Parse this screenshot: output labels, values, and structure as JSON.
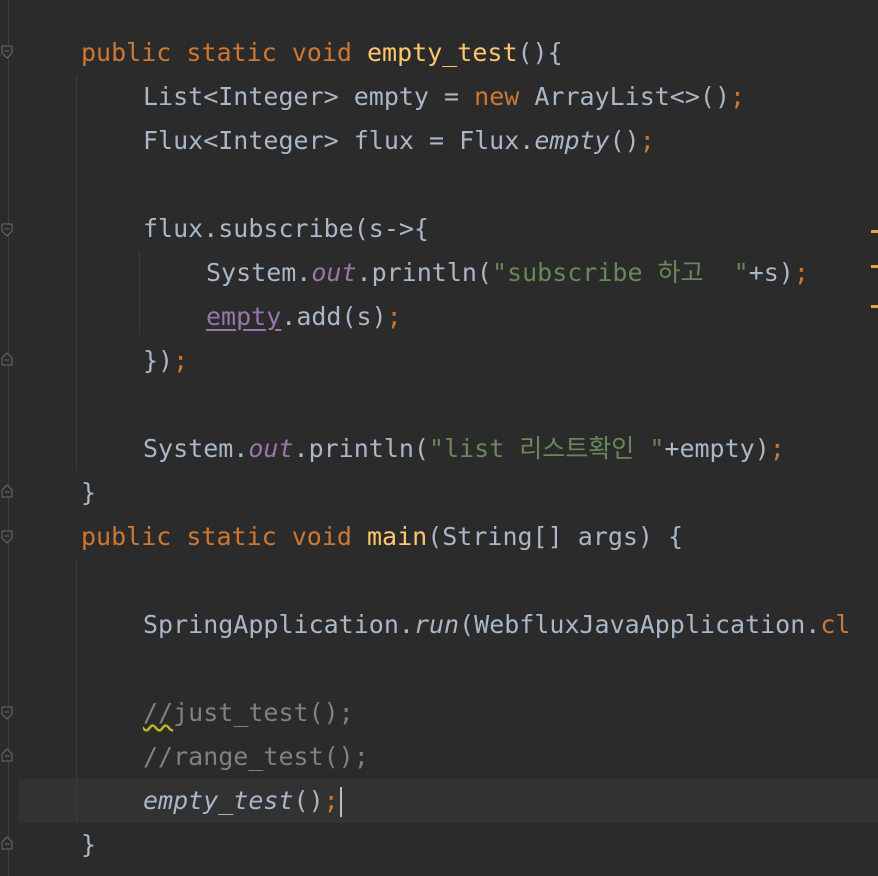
{
  "editor": {
    "code": {
      "l1": {
        "kw": "public static void ",
        "fn": "empty_test",
        "rest": "(){"
      },
      "l2": {
        "pre": "List<Integer> empty = ",
        "kw": "new",
        "post": " ArrayList<>()",
        "semi": ";"
      },
      "l3": {
        "pre": "Flux<Integer> flux = Flux.",
        "call": "empty",
        "post": "()",
        "semi": ";"
      },
      "l5": {
        "text": "flux.subscribe(s->{"
      },
      "l6": {
        "pre": "System.",
        "field": "out",
        "mid": ".println(",
        "str": "\"subscribe 하고  \"",
        "post": "+s)",
        "semi": ";"
      },
      "l7": {
        "captured": "empty",
        "post": ".add(s)",
        "semi": ";"
      },
      "l8": {
        "pre": "})",
        "semi": ";"
      },
      "l10": {
        "pre": "System.",
        "field": "out",
        "mid": ".println(",
        "str": "\"list 리스트확인 \"",
        "post": "+empty)",
        "semi": ";"
      },
      "l11": {
        "text": "}"
      },
      "l12": {
        "kw": "public static void ",
        "fn": "main",
        "rest": "(String[] args) {"
      },
      "l14": {
        "pre": "SpringApplication.",
        "call": "run",
        "mid": "(WebfluxJavaApplication.",
        "cut": "cl"
      },
      "l16": {
        "squiggle": "//",
        "rest": "just_test();"
      },
      "l17": {
        "text": "//range_test();"
      },
      "l18": {
        "call": "empty_test",
        "post": "()",
        "semi": ";"
      },
      "l19": {
        "text": "}"
      }
    },
    "colors": {
      "background": "#2b2b2b",
      "current_line": "#323232",
      "keyword": "#cc7832",
      "method_decl": "#ffc66d",
      "string": "#6a8759",
      "static_field": "#9876aa",
      "comment": "#808080",
      "default_text": "#a9b7c6",
      "warning_marker": "#e8a33d"
    }
  }
}
